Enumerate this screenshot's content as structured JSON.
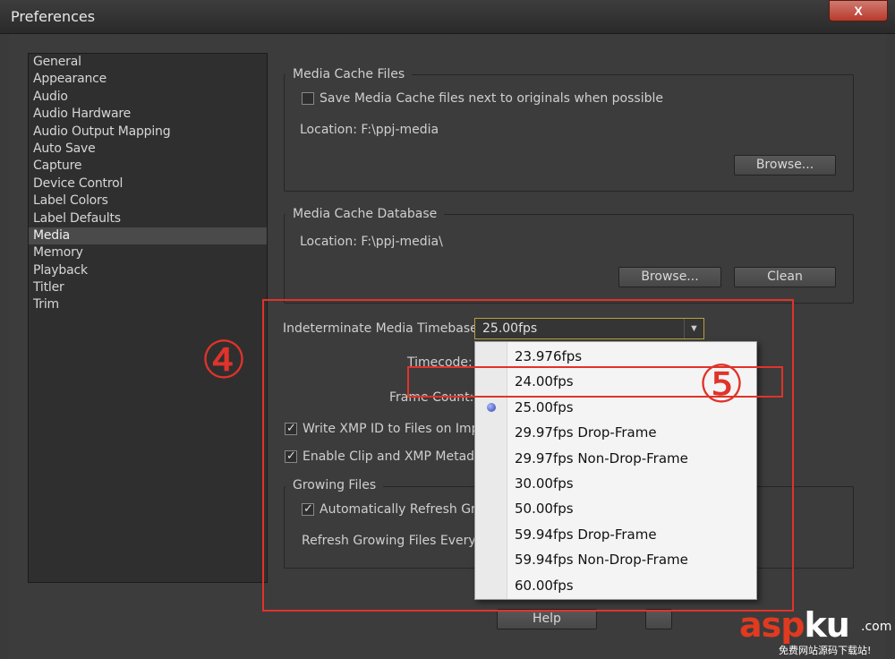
{
  "window": {
    "title": "Preferences",
    "close_label": "X"
  },
  "sidebar": {
    "items": [
      {
        "label": "General"
      },
      {
        "label": "Appearance"
      },
      {
        "label": "Audio"
      },
      {
        "label": "Audio Hardware"
      },
      {
        "label": "Audio Output Mapping"
      },
      {
        "label": "Auto Save"
      },
      {
        "label": "Capture"
      },
      {
        "label": "Device Control"
      },
      {
        "label": "Label Colors"
      },
      {
        "label": "Label Defaults"
      },
      {
        "label": "Media"
      },
      {
        "label": "Memory"
      },
      {
        "label": "Playback"
      },
      {
        "label": "Titler"
      },
      {
        "label": "Trim"
      }
    ],
    "selected": "Media"
  },
  "media_cache_files": {
    "title": "Media Cache Files",
    "checkbox_label": "Save Media Cache files next to originals when possible",
    "checked": false,
    "location": "Location:  F:\\ppj-media",
    "browse_label": "Browse..."
  },
  "media_cache_database": {
    "title": "Media Cache Database",
    "location": "Location:  F:\\ppj-media\\",
    "browse_label": "Browse...",
    "clean_label": "Clean"
  },
  "timebase": {
    "label": "Indeterminate Media Timebase:",
    "value": "25.00fps"
  },
  "timecode_label": "Timecode:",
  "frame_count_label": "Frame Count:",
  "write_xmp": {
    "label": "Write XMP ID to Files on Impo",
    "checked": true
  },
  "enable_clip_xmp": {
    "label": "Enable Clip and XMP Metadata",
    "checked": true
  },
  "growing_files": {
    "title": "Growing Files",
    "auto_refresh_label": "Automatically Refresh Grow",
    "auto_refresh_checked": true,
    "refresh_every_label": "Refresh Growing Files Every"
  },
  "dropdown": {
    "options": [
      "23.976fps",
      "24.00fps",
      "25.00fps",
      "29.97fps Drop-Frame",
      "29.97fps Non-Drop-Frame",
      "30.00fps",
      "50.00fps",
      "59.94fps Drop-Frame",
      "59.94fps Non-Drop-Frame",
      "60.00fps"
    ],
    "selected_index": 2
  },
  "footer": {
    "help_label": "Help"
  },
  "annotations": {
    "four": "④",
    "five": "⑤",
    "color": "#e0332a"
  },
  "watermark": {
    "main_accent": "asp",
    "main_white": "ku",
    "com": ".com",
    "sub": "免费网站源码下载站!"
  }
}
